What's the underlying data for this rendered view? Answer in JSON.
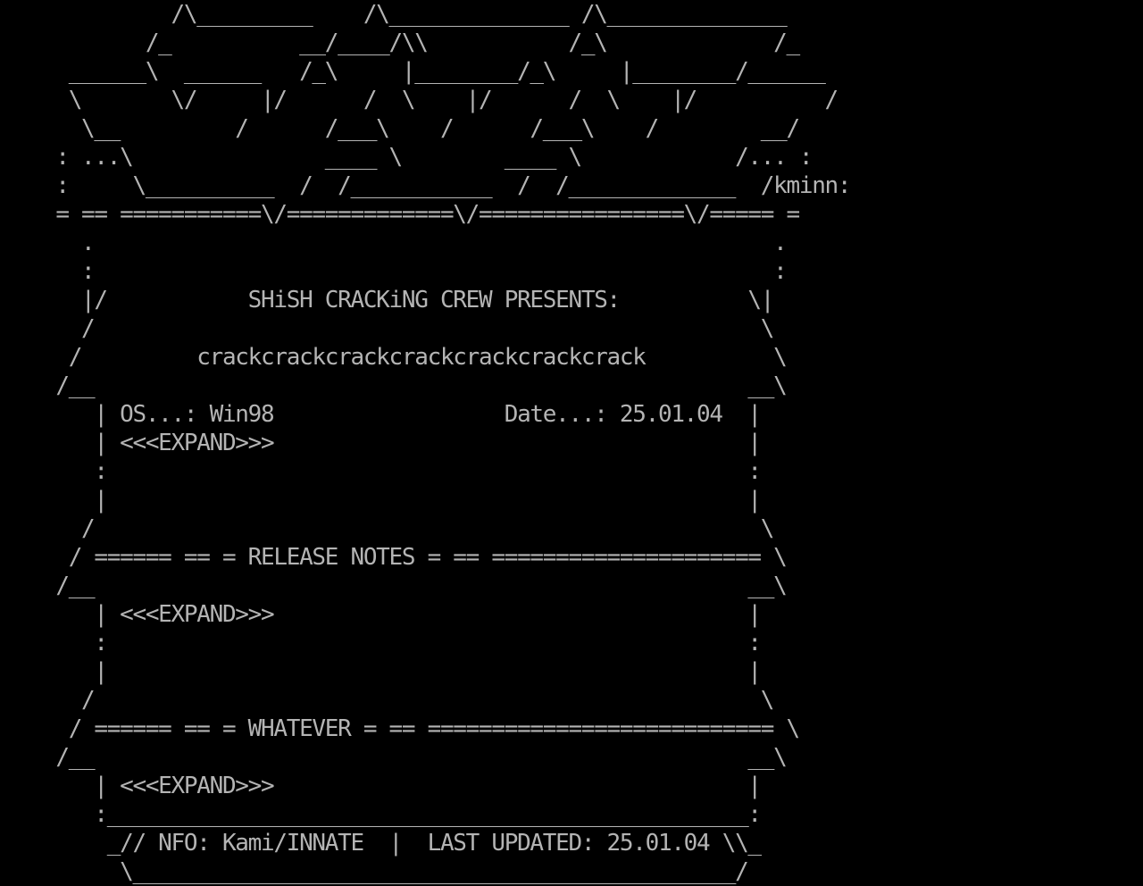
{
  "screen": {
    "background": "#000000",
    "foreground": "#b4b4b4"
  },
  "nfo": {
    "lines": [
      "          /\\_________    /\\______________ /\\______________",
      "        /_          __/____/\\\\           /_\\             /_",
      "  ______\\  ______   /_\\     |________/_\\     |________/______",
      "  \\       \\/     |/      /  \\    |/      /  \\    |/          /",
      "   \\__         /      /___\\    /      /___\\    /        __/",
      " : ...\\               ____ \\        ____ \\            /... :",
      " :     \\__________  /  /___________  /  /_____________  /kminn:",
      " = == ===========\\/=============\\/================\\/===== =",
      "   .                                                     .",
      "   :                                                     :",
      "   |/           SHiSH CRACKiNG CREW PRESENTS:          \\|",
      "   /                                                    \\",
      "  /         crackcrackcrackcrackcrackcrackcrack          \\",
      " /__                                                   __\\",
      "    | OS...: Win98                  Date...: 25.01.04  |",
      "    | <<<EXPAND>>>                                     |",
      "    :                                                  :",
      "    |                                                  |",
      "   /                                                    \\",
      "  / ====== == = RELEASE NOTES = == ===================== \\",
      " /__                                                   __\\",
      "    | <<<EXPAND>>>                                     |",
      "    :                                                  :",
      "    |                                                  |",
      "   /                                                    \\",
      "  / ====== == = WHATEVER = == =========================== \\",
      " /__                                                   __\\",
      "    | <<<EXPAND>>>                                     |",
      "    :__________________________________________________:",
      "     _// NFO: Kami/INNATE  |  LAST UPDATED: 25.01.04 \\\\_",
      "      \\_______________________________________________/"
    ]
  }
}
